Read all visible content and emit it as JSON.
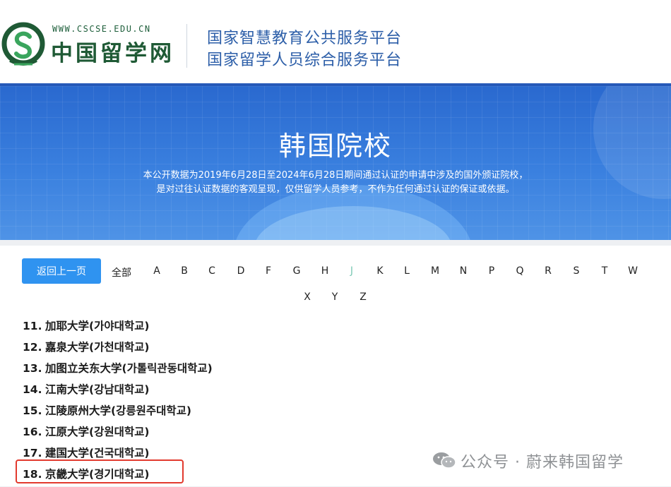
{
  "header": {
    "logo_url": "WWW.CSCSE.EDU.CN",
    "logo_name": "中国留学网",
    "line1": "国家智慧教育公共服务平台",
    "line2": "国家留学人员综合服务平台"
  },
  "banner": {
    "title": "韩国院校",
    "desc_line1": "本公开数据为2019年6月28日至2024年6月28日期间通过认证的申请中涉及的国外颁证院校，",
    "desc_line2": "是对过往认证数据的客观呈现，仅供留学人员参考，不作为任何通过认证的保证或依据。"
  },
  "nav": {
    "back_label": "返回上一页",
    "letters": [
      "全部",
      "A",
      "B",
      "C",
      "D",
      "F",
      "G",
      "H",
      "J",
      "K",
      "L",
      "M",
      "N",
      "P",
      "Q",
      "R",
      "S",
      "T",
      "W",
      "X",
      "Y",
      "Z"
    ],
    "active_letter": "J"
  },
  "schools": [
    {
      "num": "11.",
      "name": "加耶大学(가야대학교)"
    },
    {
      "num": "12.",
      "name": "嘉泉大学(가천대학교)"
    },
    {
      "num": "13.",
      "name": "加图立关东大学(가톨릭관동대학교)"
    },
    {
      "num": "14.",
      "name": "江南大学(강남대학교)"
    },
    {
      "num": "15.",
      "name": "江陵原州大学(강릉원주대학교)"
    },
    {
      "num": "16.",
      "name": "江原大学(강원대학교)"
    },
    {
      "num": "17.",
      "name": "建国大学(건국대학교)"
    },
    {
      "num": "18.",
      "name": "京畿大学(경기대학교)"
    }
  ],
  "highlighted_school": "18.",
  "watermark": {
    "text": "公众号 · 蔚来韩国留学",
    "icon": "wechat-icon"
  },
  "colors": {
    "brand_green": "#1f5a35",
    "header_blue": "#2c5ea8",
    "banner_blue": "#3a80df",
    "button_blue": "#2f93f0",
    "active_letter": "#7dc9b5",
    "highlight_red": "#e23a2e"
  }
}
